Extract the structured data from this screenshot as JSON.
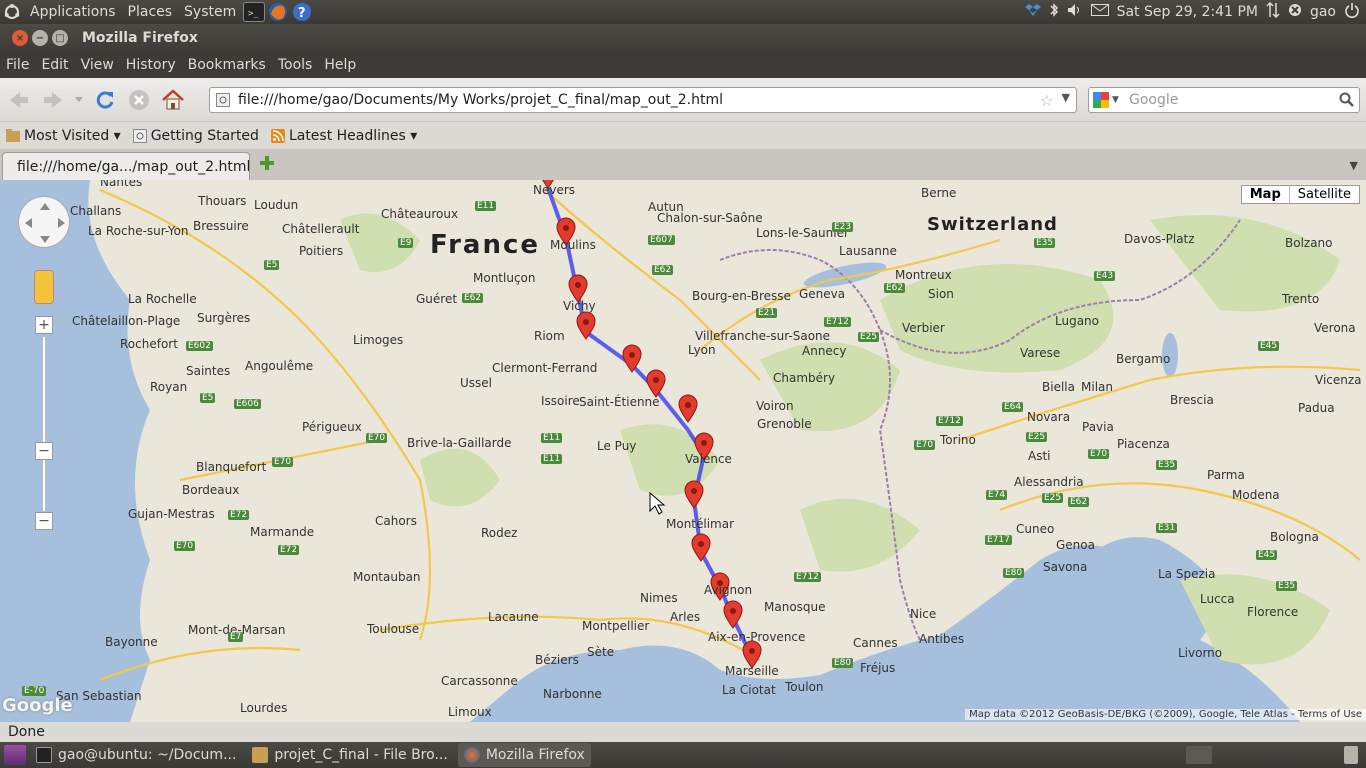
{
  "top_panel": {
    "menus": [
      "Applications",
      "Places",
      "System"
    ],
    "clock": "Sat Sep 29,  2:41 PM",
    "user": "gao"
  },
  "window": {
    "title": "Mozilla Firefox"
  },
  "menubar": [
    "File",
    "Edit",
    "View",
    "History",
    "Bookmarks",
    "Tools",
    "Help"
  ],
  "navbar": {
    "url": "file:///home/gao/Documents/My Works/projet_C_final/map_out_2.html",
    "search_placeholder": "Google"
  },
  "bookmarks": [
    {
      "label": "Most Visited ▾"
    },
    {
      "label": "Getting Started"
    },
    {
      "label": "Latest Headlines ▾"
    }
  ],
  "tabs": [
    {
      "label": "file:///home/ga.../map_out_2.html"
    }
  ],
  "map": {
    "type_buttons": [
      "Map",
      "Satellite"
    ],
    "country_labels": [
      "France",
      "Switzerland"
    ],
    "city_labels": [
      "Nantes",
      "Challans",
      "Thouars",
      "Loudun",
      "Châteauroux",
      "Autun",
      "Chalon-sur-Saône",
      "Lons-le-Saunier",
      "Berne",
      "La Roche-sur-Yon",
      "Bressuire",
      "Châtellerault",
      "Moulins",
      "Lausanne",
      "Davos-Platz",
      "Bolzano",
      "Poitiers",
      "Montluçon",
      "Montreux",
      "La Rochelle",
      "Guéret",
      "Vichy",
      "Bourg-en-Bresse",
      "Geneva",
      "Sion",
      "Trento",
      "Châtelaillon-Plage",
      "Surgères",
      "Lugano",
      "Rochefort",
      "Limoges",
      "Riom",
      "Villefranche-sur-Saone",
      "Annecy",
      "Verbier",
      "Verona",
      "Saintes",
      "Angoulême",
      "Ussel",
      "Clermont-Ferrand",
      "Lyon",
      "Chambéry",
      "Varese",
      "Bergamo",
      "Vicenza",
      "Royan",
      "Issoire",
      "Saint-Étienne",
      "Voiron",
      "Biella",
      "Milan",
      "Brescia",
      "Padua",
      "Périgueux",
      "Brive-la-Gaillarde",
      "Le Puy",
      "Grenoble",
      "Novara",
      "Pavia",
      "Torino",
      "Piacenza",
      "Blanquefort",
      "Valence",
      "Asti",
      "Parma",
      "Bordeaux",
      "Alessandria",
      "Modena",
      "Gujan-Mestras",
      "Cahors",
      "Montélimar",
      "Cuneo",
      "Bologna",
      "Marmande",
      "Rodez",
      "Savona",
      "Genoa",
      "Montauban",
      "La Spezia",
      "Nimes",
      "Arles",
      "Manosque",
      "Lucca",
      "Florence",
      "Toulouse",
      "Montpellier",
      "Nice",
      "Antibes",
      "Mont-de-Marsan",
      "Lacaune",
      "Bayonne",
      "Béziers",
      "Sète",
      "Aix-en-Provence",
      "Cannes",
      "Fréjus",
      "Livorno",
      "Carcassonne",
      "Marseille",
      "Toulon",
      "San Sebastian",
      "Narbonne",
      "La Ciotat",
      "Lourdes",
      "Limoux",
      "Nevers",
      "Avignon"
    ],
    "attribution": "Map data ©2012 GeoBasis-DE/BKG (©2009), Google, Tele Atlas - Terms of Use",
    "google_logo": "Google",
    "route_color": "#4444ee",
    "marker_color": "#e33b2e"
  },
  "status": "Done",
  "taskbar": [
    {
      "label": "gao@ubuntu: ~/Docum..."
    },
    {
      "label": "projet_C_final - File Bro..."
    },
    {
      "label": "Mozilla Firefox"
    }
  ]
}
